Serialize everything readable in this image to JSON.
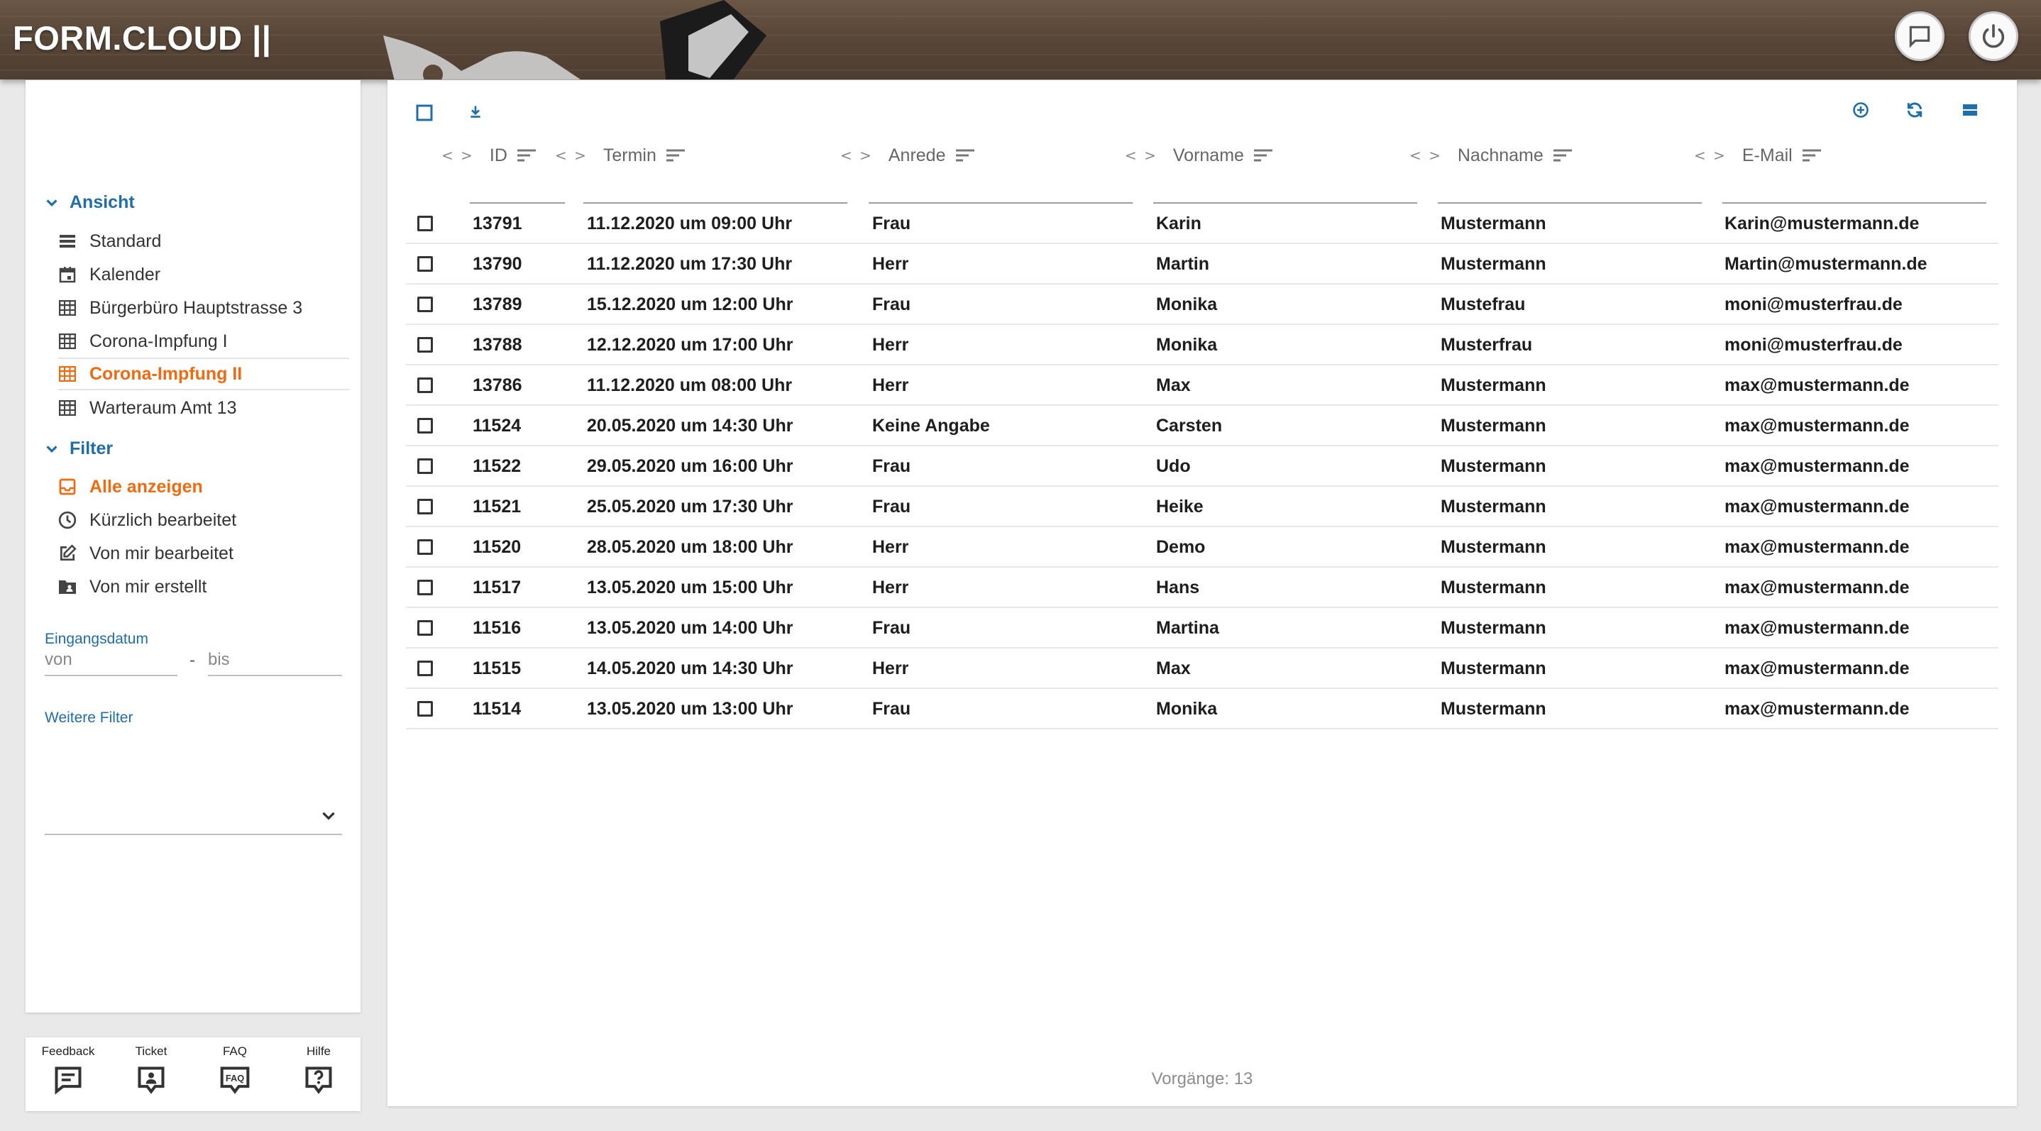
{
  "app": {
    "brand": "FORM.CLOUD ||"
  },
  "sidebar": {
    "ansicht_label": "Ansicht",
    "views": [
      {
        "label": "Standard",
        "icon": "list-icon"
      },
      {
        "label": "Kalender",
        "icon": "calendar-icon"
      },
      {
        "label": "Bürgerbüro Hauptstrasse 3",
        "icon": "table-icon"
      },
      {
        "label": "Corona-Impfung I",
        "icon": "table-icon"
      },
      {
        "label": "Corona-Impfung II",
        "icon": "table-icon",
        "active": true
      },
      {
        "label": "Warteraum Amt 13",
        "icon": "table-icon"
      }
    ],
    "filter_label": "Filter",
    "filters": [
      {
        "label": "Alle anzeigen",
        "icon": "inbox-icon",
        "active": true
      },
      {
        "label": "Kürzlich bearbeitet",
        "icon": "clock-icon"
      },
      {
        "label": "Von mir bearbeitet",
        "icon": "edit-icon"
      },
      {
        "label": "Von mir erstellt",
        "icon": "folder-user-icon"
      }
    ],
    "eingangsdatum_label": "Eingangsdatum",
    "von_placeholder": "von",
    "bis_placeholder": "bis",
    "date_separator": "-",
    "weitere_filter_label": "Weitere Filter"
  },
  "footer": {
    "feedback": "Feedback",
    "ticket": "Ticket",
    "faq": "FAQ",
    "faq_icon_text": "FAQ",
    "hilfe": "Hilfe"
  },
  "table": {
    "columns": [
      "ID",
      "Termin",
      "Anrede",
      "Vorname",
      "Nachname",
      "E-Mail"
    ],
    "rows": [
      [
        "13791",
        "11.12.2020 um 09:00 Uhr",
        "Frau",
        "Karin",
        "Mustermann",
        "Karin@mustermann.de"
      ],
      [
        "13790",
        "11.12.2020 um 17:30 Uhr",
        "Herr",
        "Martin",
        "Mustermann",
        "Martin@mustermann.de"
      ],
      [
        "13789",
        "15.12.2020 um 12:00 Uhr",
        "Frau",
        "Monika",
        "Mustefrau",
        "moni@musterfrau.de"
      ],
      [
        "13788",
        "12.12.2020 um 17:00 Uhr",
        "Herr",
        "Monika",
        "Musterfrau",
        "moni@musterfrau.de"
      ],
      [
        "13786",
        "11.12.2020 um 08:00 Uhr",
        "Herr",
        "Max",
        "Mustermann",
        "max@mustermann.de"
      ],
      [
        "11524",
        "20.05.2020 um 14:30 Uhr",
        "Keine Angabe",
        "Carsten",
        "Mustermann",
        "max@mustermann.de"
      ],
      [
        "11522",
        "29.05.2020 um 16:00 Uhr",
        "Frau",
        "Udo",
        "Mustermann",
        "max@mustermann.de"
      ],
      [
        "11521",
        "25.05.2020 um 17:30 Uhr",
        "Frau",
        "Heike",
        "Mustermann",
        "max@mustermann.de"
      ],
      [
        "11520",
        "28.05.2020 um 18:00 Uhr",
        "Herr",
        "Demo",
        "Mustermann",
        "max@mustermann.de"
      ],
      [
        "11517",
        "13.05.2020 um 15:00 Uhr",
        "Herr",
        "Hans",
        "Mustermann",
        "max@mustermann.de"
      ],
      [
        "11516",
        "13.05.2020 um 14:00 Uhr",
        "Frau",
        "Martina",
        "Mustermann",
        "max@mustermann.de"
      ],
      [
        "11515",
        "14.05.2020 um 14:30 Uhr",
        "Herr",
        "Max",
        "Mustermann",
        "max@mustermann.de"
      ],
      [
        "11514",
        "13.05.2020 um 13:00 Uhr",
        "Frau",
        "Monika",
        "Mustermann",
        "max@mustermann.de"
      ]
    ],
    "status": "Vorgänge: 13"
  },
  "colors": {
    "accent_blue": "#1f6ea8",
    "active_orange": "#ee6b12"
  }
}
